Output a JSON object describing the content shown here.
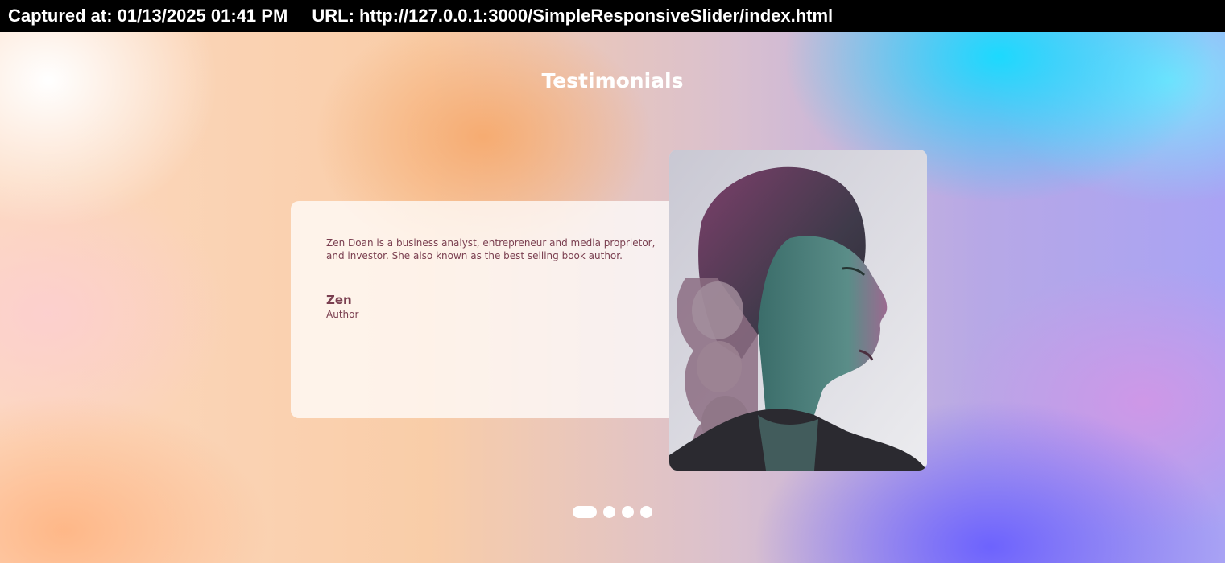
{
  "capture": {
    "captured_label": "Captured at: 01/13/2025 01:41 PM",
    "url_label": "URL: http://127.0.0.1:3000/SimpleResponsiveSlider/index.html"
  },
  "section": {
    "title": "Testimonials"
  },
  "testimonial": {
    "quote": "Zen Doan is a business analyst, entrepreneur and media proprietor, and investor. She also known as the best selling book author.",
    "name": "Zen",
    "role": "Author"
  },
  "slider": {
    "total_slides": 4,
    "active_index": 0
  },
  "colors": {
    "accent_text": "#7a3f50",
    "title": "#ffffff"
  }
}
